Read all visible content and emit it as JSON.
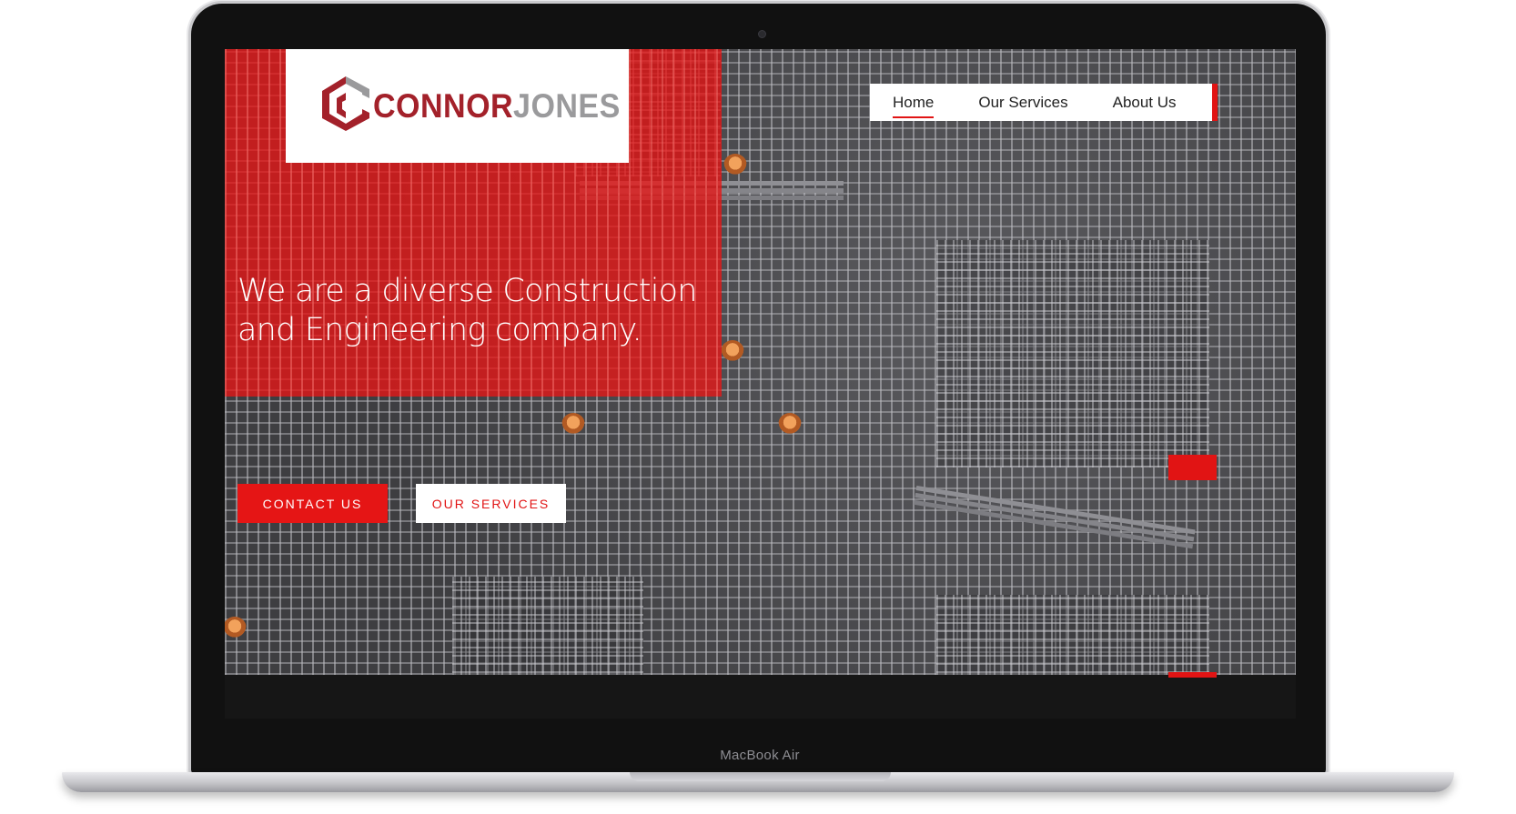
{
  "device": {
    "label": "MacBook Air"
  },
  "brand": {
    "name_first": "CONNOR",
    "name_second": "JONES",
    "color_primary": "#a3212a",
    "color_secondary": "#9a9a9c"
  },
  "nav": {
    "items": [
      {
        "label": "Home",
        "active": true
      },
      {
        "label": "Our Services"
      },
      {
        "label": "About Us"
      }
    ]
  },
  "hero": {
    "headline_line1": "We are a diverse Construction",
    "headline_line2": "and Engineering company.",
    "overlay_color": "#e81616"
  },
  "buttons": {
    "contact_label": "CONTACT US",
    "services_label": "OUR SERVICES"
  },
  "colors": {
    "accent": "#e11414"
  }
}
